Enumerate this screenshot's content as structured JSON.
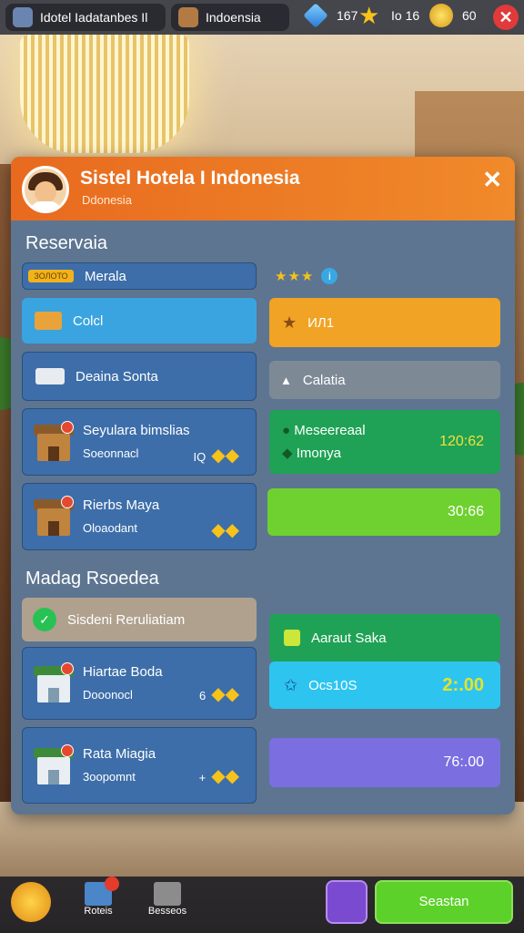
{
  "topbar": {
    "hotel_tab": "Idotel Iadatanbes Il",
    "location_tab": "Indoensia",
    "stat_1": "167",
    "stat_2": "Io 16",
    "stat_3": "60"
  },
  "panel": {
    "title": "Sistel Hotela I Indonesia",
    "subtitle": "Ddonesia",
    "reservation_title": "Reservaia",
    "rows_left": [
      {
        "tag": "ЗОЛОТО",
        "label": "Merala"
      },
      {
        "label": "Colcl"
      },
      {
        "label": "Deaina Sonta"
      },
      {
        "line1": "Seyulara bimslias",
        "line2": "Soeonnacl",
        "extra": "IQ"
      },
      {
        "line1": "Rierbs Maya",
        "line2": "Oloaodant",
        "extra": ""
      }
    ],
    "rows_right": [
      {
        "stars": "★★★",
        "info": "i"
      },
      {
        "label": "ИЛ1"
      },
      {
        "label": "Calatia"
      },
      {
        "line1": "Meseereaal",
        "line2": "Imonya",
        "time": "120:62"
      },
      {
        "time": "30:66"
      }
    ],
    "section2_title": "Madag Rsoedea",
    "rows2_left": [
      {
        "label": "Sisdeni Reruliatiam"
      },
      {
        "line1": "Hiartae Boda",
        "line2": "Dooonocl",
        "extra": "6"
      },
      {
        "line1": "Rata Miagia",
        "line2": "3oopomnt",
        "extra": "+"
      }
    ],
    "rows2_right": [
      {
        "label": "Aaraut Saka"
      },
      {
        "label": "Ocs10S",
        "time": "2:.00"
      },
      {
        "time": "76:.00"
      }
    ]
  },
  "bottom": {
    "tab_1": "Roteis",
    "tab_2": "Besseos",
    "action_button": "Seastan"
  }
}
